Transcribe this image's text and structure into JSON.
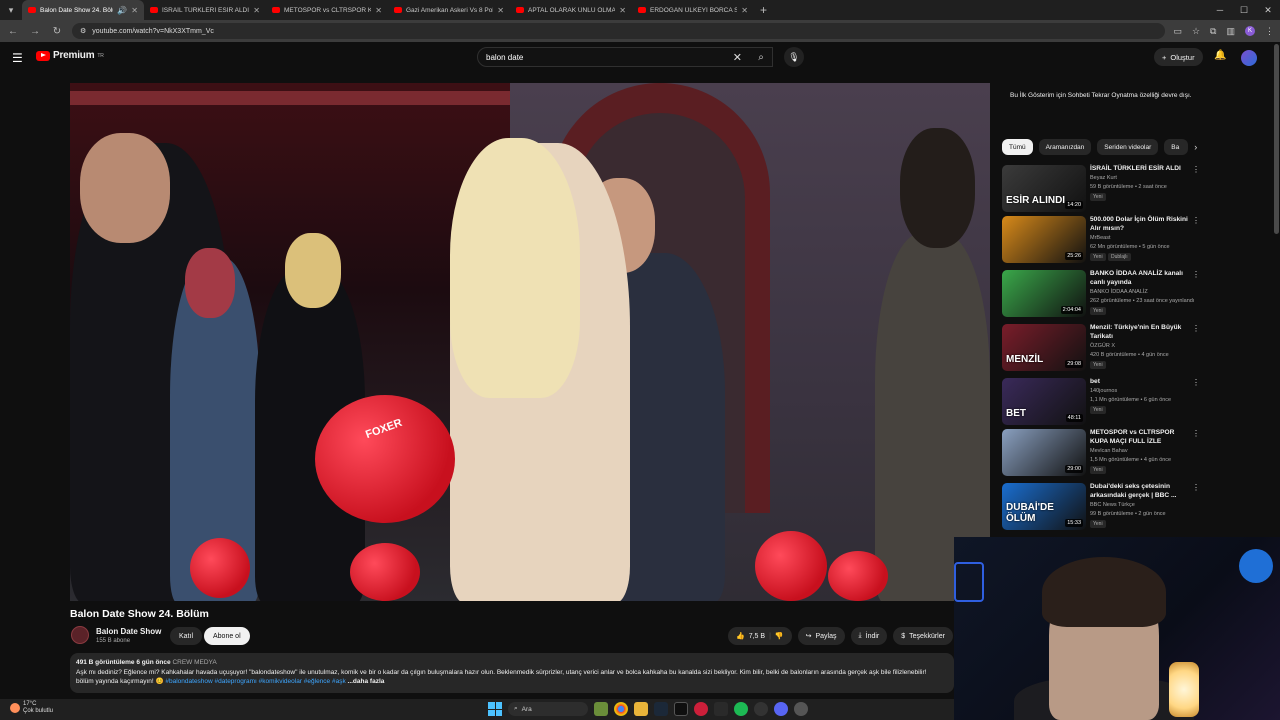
{
  "browser": {
    "tabs": [
      {
        "title": "Balon Date Show 24. Bölüm",
        "active": true
      },
      {
        "title": "İSRAİL TÜRKLERİ ESİR ALDI - Yo"
      },
      {
        "title": "METOSPOR vs CLTRSPOR KUPA"
      },
      {
        "title": "Gazi Amerikan Askeri Vs 8 Polis"
      },
      {
        "title": "APTAL OLARAK ÜNLÜ OLMAK"
      },
      {
        "title": "ERDOĞAN ÜLKEYİ BORCA SOK"
      }
    ],
    "url": "youtube.com/watch?v=NkX3XTmm_Vc"
  },
  "header": {
    "logo_text": "Premium",
    "logo_sup": "TR",
    "search_value": "balon date",
    "create_label": "Oluştur"
  },
  "video": {
    "title": "Balon Date Show 24. Bölüm",
    "overlay_brand": "FOXER",
    "channel_name": "Balon Date Show",
    "subscribers": "155 B abone",
    "join_label": "Katıl",
    "subscribe_label": "Abone ol",
    "likes": "7,5 B",
    "share_label": "Paylaş",
    "download_label": "İndir",
    "thanks_label": "Teşekkürler"
  },
  "description": {
    "views": "491 B görüntüleme",
    "age": "6 gün önce",
    "channel_tag": "CREW MEDYA",
    "line1": "Aşk mı dediniz? Eğlence mi? Kahkahalar havada uçuşuyor! \"balondateshow\" ile unutulmaz, komik ve bir o kadar da çılgın buluşmalara hazır olun. Beklenmedik sürprizler, utanç verici anlar ve bolca kahkaha bu kanalda sizi bekliyor. Kim bilir, belki de balonların arasında gerçek aşk bile filizlenebilir!",
    "line2_prefix": "bölüm yayında kaçırmayın! 😊",
    "hashtags": "#balondateshow #dateprogramı #komikvideolar #eğlence #aşk",
    "more_label": "...daha fazla"
  },
  "sidebar": {
    "chat_note": "Bu İlk Gösterim için Sohbeti Tekrar Oynatma özelliği devre dışı.",
    "chips": [
      "Tümü",
      "Aramanızdan",
      "Seriden videolar",
      "Ba"
    ],
    "recommendations": [
      {
        "title": "İSRAİL TÜRKLERİ ESİR ALDI",
        "channel": "Beyaz Kurt",
        "meta": "59 B görüntüleme • 2 saat önce",
        "badge": "Yeni",
        "duration": "14:20",
        "thumb_text": "ESİR ALINDI",
        "thumb_color": "#3b3b3b"
      },
      {
        "title": "500.000 Dolar İçin Ölüm Riskini Alır mısın?",
        "channel": "MrBeast",
        "meta": "62 Mn görüntüleme • 5 gün önce",
        "badge": "Yeni",
        "badge2": "Dublajlı",
        "duration": "25:26",
        "thumb_text": "",
        "thumb_color": "#d88a1a"
      },
      {
        "title": "BANKO İDDAA ANALİZ kanalı canlı yayında",
        "channel": "BANKO İDDAA ANALİZ",
        "meta": "262 görüntüleme • 23 saat önce yayınlandı",
        "badge": "Yeni",
        "duration": "2:04:04",
        "thumb_text": "",
        "thumb_color": "#3aa84a"
      },
      {
        "title": "Menzil: Türkiye'nin En Büyük Tarikatı",
        "channel": "ÖZGÜR X",
        "meta": "420 B görüntüleme • 4 gün önce",
        "badge": "Yeni",
        "duration": "29:08",
        "thumb_text": "MENZİL",
        "thumb_color": "#7a1d2a"
      },
      {
        "title": "bet",
        "channel": "140journos",
        "meta": "1,1 Mn görüntüleme • 6 gün önce",
        "badge": "Yeni",
        "duration": "48:11",
        "thumb_text": "BET",
        "thumb_color": "#3a2a5a"
      },
      {
        "title": "METOSPOR vs CLTRSPOR KUPA MAÇI FULL İZLE",
        "channel": "Mevlcan Bahav",
        "meta": "1,5 Mn görüntüleme • 4 gün önce",
        "badge": "Yeni",
        "duration": "29:00",
        "thumb_text": "",
        "thumb_color": "#8aa0c0"
      },
      {
        "title": "Dubai'deki seks çetesinin arkasındaki gerçek | BBC ...",
        "channel": "BBC News Türkçe",
        "meta": "99 B görüntüleme • 2 gün önce",
        "badge": "Yeni",
        "duration": "15:33",
        "thumb_text": "DUBAİ'DE ÖLÜM",
        "thumb_color": "#1a6ed0"
      }
    ]
  },
  "taskbar": {
    "temp": "17°C",
    "weather": "Çok bulutlu",
    "search_label": "Ara"
  }
}
